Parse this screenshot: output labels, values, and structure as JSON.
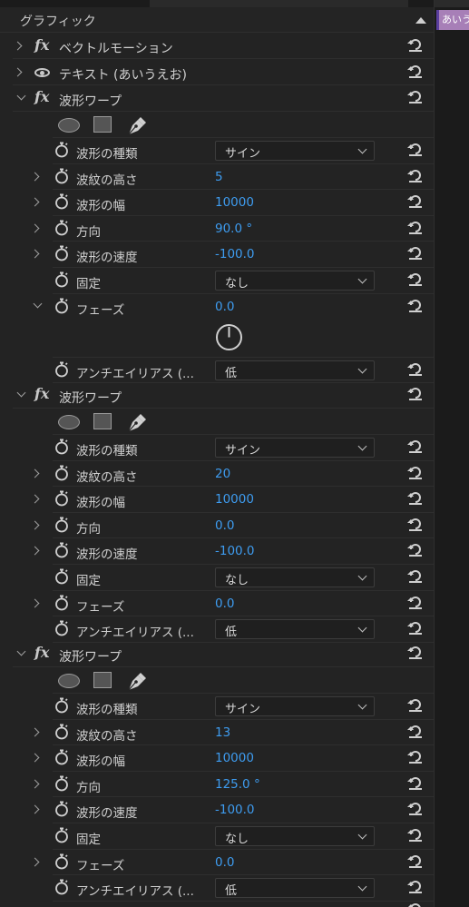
{
  "panel": {
    "title": "グラフィック",
    "collapse_icon": "triangle-up-icon"
  },
  "timeline": {
    "clip_label": "あいう"
  },
  "effects": {
    "vector_motion": {
      "label": "ベクトルモーション",
      "icon": "fx-icon"
    },
    "text": {
      "label": "テキスト (あいうえお)",
      "icon": "eye-icon"
    }
  },
  "warps": [
    {
      "label": "波形ワープ",
      "wave_type": {
        "label": "波形の種類",
        "value": "サイン"
      },
      "wave_height": {
        "label": "波紋の高さ",
        "value": "5"
      },
      "wave_width": {
        "label": "波形の幅",
        "value": "10000"
      },
      "direction": {
        "label": "方向",
        "value": "90.0 °"
      },
      "wave_speed": {
        "label": "波形の速度",
        "value": "-100.0"
      },
      "pinning": {
        "label": "固定",
        "value": "なし"
      },
      "phase": {
        "label": "フェーズ",
        "value": "0.0"
      },
      "antialias": {
        "label": "アンチエイリアス (...",
        "value": "低"
      }
    },
    {
      "label": "波形ワープ",
      "wave_type": {
        "label": "波形の種類",
        "value": "サイン"
      },
      "wave_height": {
        "label": "波紋の高さ",
        "value": "20"
      },
      "wave_width": {
        "label": "波形の幅",
        "value": "10000"
      },
      "direction": {
        "label": "方向",
        "value": "0.0"
      },
      "wave_speed": {
        "label": "波形の速度",
        "value": "-100.0"
      },
      "pinning": {
        "label": "固定",
        "value": "なし"
      },
      "phase": {
        "label": "フェーズ",
        "value": "0.0"
      },
      "antialias": {
        "label": "アンチエイリアス (...",
        "value": "低"
      }
    },
    {
      "label": "波形ワープ",
      "wave_type": {
        "label": "波形の種類",
        "value": "サイン"
      },
      "wave_height": {
        "label": "波紋の高さ",
        "value": "13"
      },
      "wave_width": {
        "label": "波形の幅",
        "value": "10000"
      },
      "direction": {
        "label": "方向",
        "value": "125.0 °"
      },
      "wave_speed": {
        "label": "波形の速度",
        "value": "-100.0"
      },
      "pinning": {
        "label": "固定",
        "value": "なし"
      },
      "phase": {
        "label": "フェーズ",
        "value": "0.0"
      },
      "antialias": {
        "label": "アンチエイリアス (...",
        "value": "低"
      }
    }
  ],
  "colors": {
    "value_blue": "#3e9cf0",
    "panel_bg": "#232323",
    "clip_purple": "#a77fb7"
  }
}
